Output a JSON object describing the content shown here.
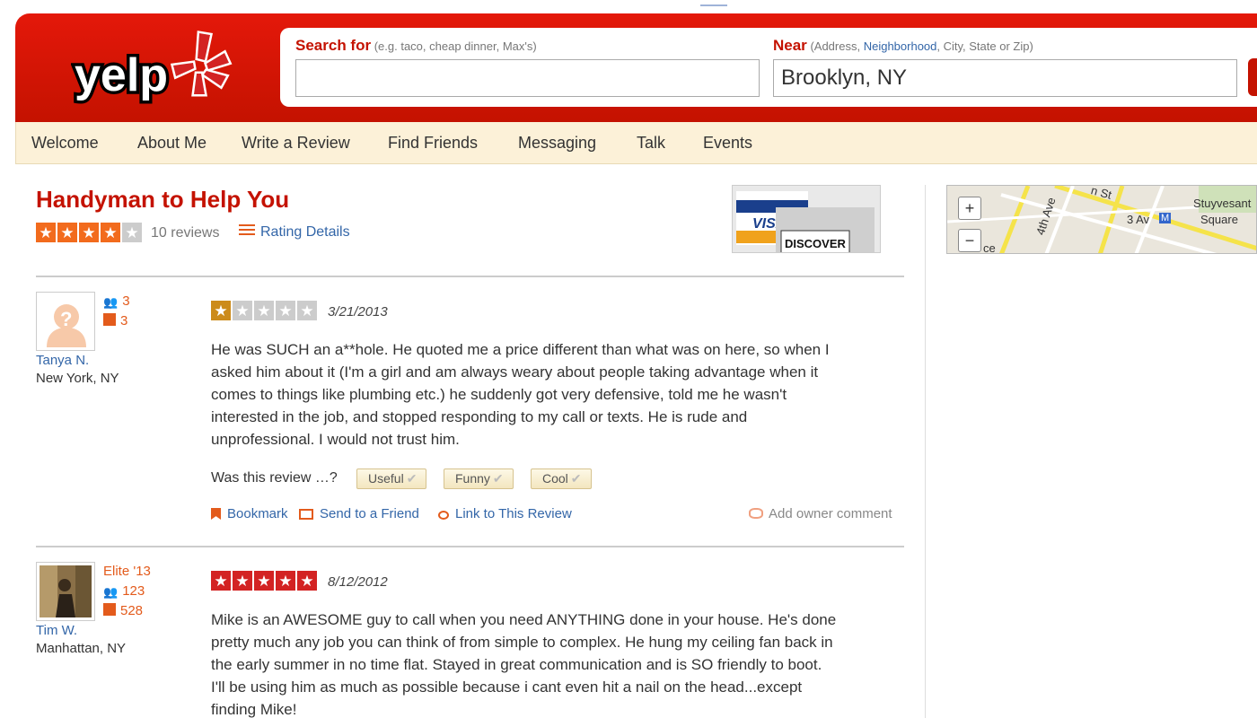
{
  "header": {
    "logo_text": "yelp",
    "search_label": "Search for",
    "search_hint": "(e.g. taco, cheap dinner, Max's)",
    "search_value": "",
    "near_label": "Near",
    "near_hint_pre": "(Address,",
    "near_hint_link": "Neighborhood",
    "near_hint_post": ", City, State or Zip)",
    "near_value": "Brooklyn, NY",
    "brand_color": "#c41200"
  },
  "nav": {
    "items": [
      "Welcome",
      "About Me",
      "Write a Review",
      "Find Friends",
      "Messaging",
      "Talk",
      "Events"
    ]
  },
  "business": {
    "title": "Handyman to Help You",
    "rating": 4,
    "rating_max": 5,
    "review_count": "10 reviews",
    "rating_details": "Rating Details",
    "cards": [
      "VISA",
      "DISCOVER"
    ]
  },
  "map": {
    "labels": [
      "4th Ave",
      "n St",
      "3 Av",
      "M",
      "Stuyvesant",
      "Square",
      "ce"
    ],
    "zoom_in": "+",
    "zoom_out": "−"
  },
  "reviews": [
    {
      "user_name": "Tanya N.",
      "user_location": "New York, NY",
      "elite": "",
      "friends": "3",
      "review_total": "3",
      "rating": 1,
      "date": "3/21/2013",
      "text": "He was SUCH an a**hole.  He quoted me a price different than what was on here, so when I\nasked him about it (I'm a girl and am always weary about people taking advantage when it\ncomes to things like plumbing etc.) he suddenly got very defensive, told me he wasn't\ninterested in the job, and stopped responding to my call or texts.  He is rude and\nunprofessional.  I would not trust him.",
      "was_this": "Was this review …?",
      "votes": [
        "Useful",
        "Funny",
        "Cool"
      ],
      "actions": [
        "Bookmark",
        "Send to a Friend",
        "Link to This Review"
      ],
      "owner_comment": "Add owner comment"
    },
    {
      "user_name": "Tim W.",
      "user_location": "Manhattan, NY",
      "elite": "Elite '13",
      "friends": "123",
      "review_total": "528",
      "rating": 5,
      "date": "8/12/2012",
      "text": "Mike is an AWESOME guy to call when you need ANYTHING done in your house.  He's done\npretty much any job you can think of from simple to complex.  He hung my ceiling fan back in\nthe early summer in no time flat.  Stayed in great communication and is SO friendly to boot.\n I'll be using him as much as possible because i cant even hit a nail on the head...except\nfinding Mike!"
    }
  ]
}
